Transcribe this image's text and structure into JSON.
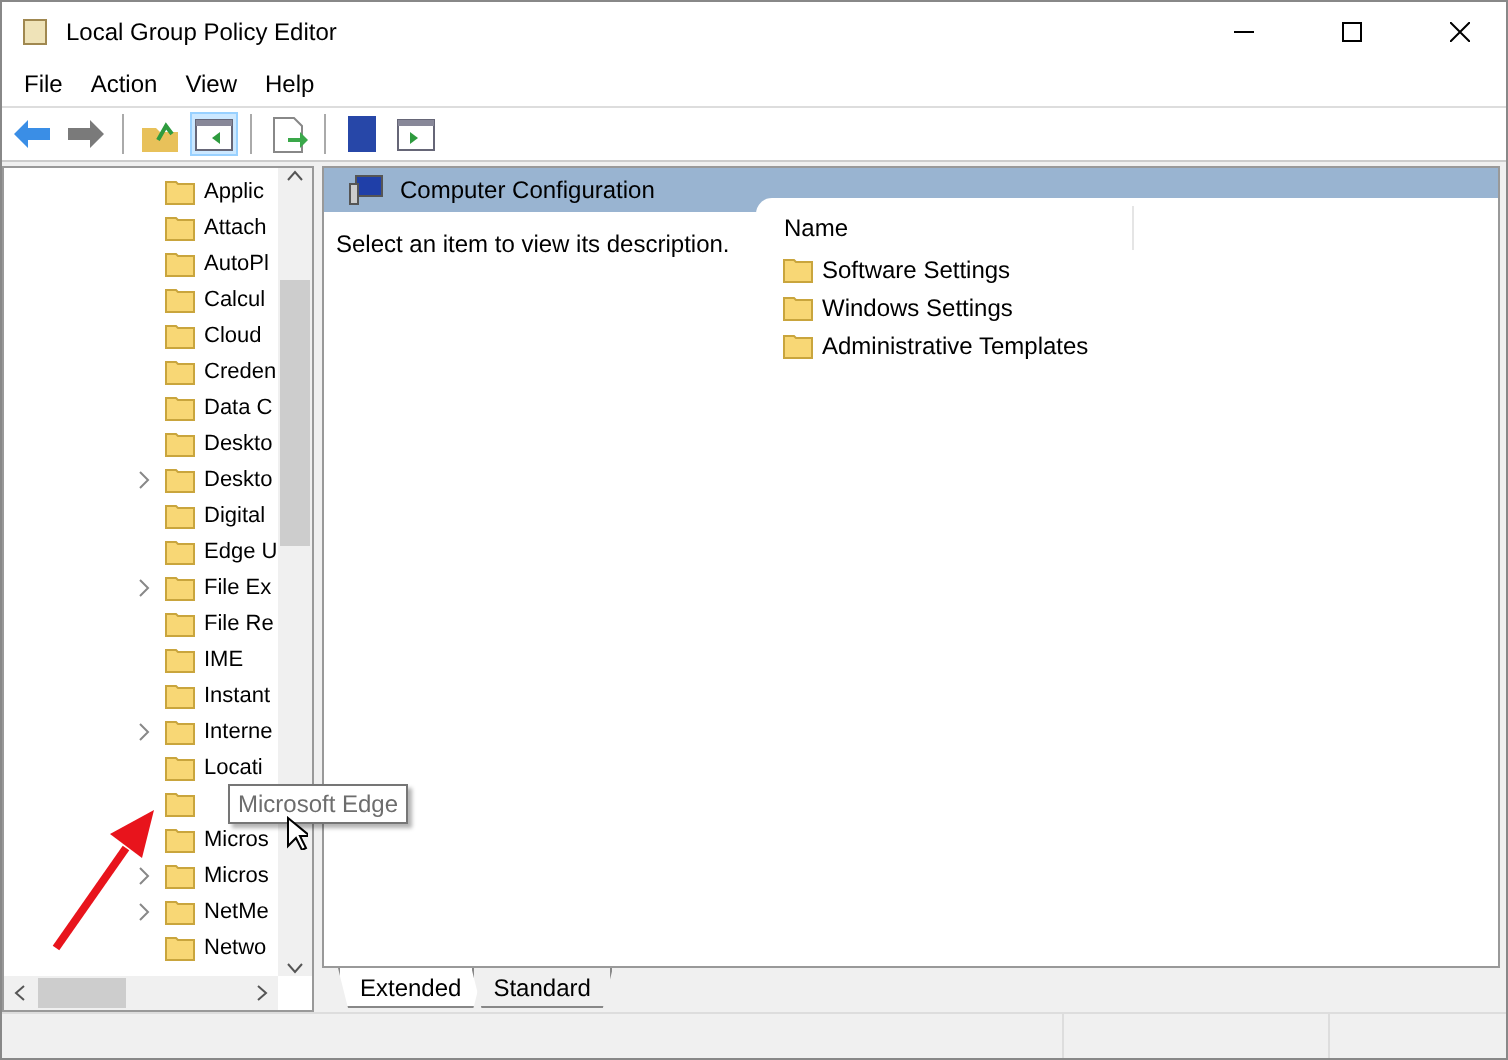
{
  "window": {
    "title": "Local Group Policy Editor"
  },
  "menu": [
    "File",
    "Action",
    "View",
    "Help"
  ],
  "toolbar": [
    {
      "kind": "back",
      "selected": false
    },
    {
      "kind": "forward",
      "selected": false
    },
    {
      "kind": "sep"
    },
    {
      "kind": "up",
      "selected": false
    },
    {
      "kind": "tree",
      "selected": true
    },
    {
      "kind": "sep"
    },
    {
      "kind": "export",
      "selected": false
    },
    {
      "kind": "sep"
    },
    {
      "kind": "help",
      "selected": false
    },
    {
      "kind": "pane",
      "selected": false
    }
  ],
  "tree": {
    "items": [
      {
        "label": "Applic",
        "expandable": false
      },
      {
        "label": "Attach",
        "expandable": false
      },
      {
        "label": "AutoPl",
        "expandable": false
      },
      {
        "label": "Calcul",
        "expandable": false
      },
      {
        "label": "Cloud",
        "expandable": false
      },
      {
        "label": "Creden",
        "expandable": false
      },
      {
        "label": "Data C",
        "expandable": false
      },
      {
        "label": "Deskto",
        "expandable": false
      },
      {
        "label": "Deskto",
        "expandable": true
      },
      {
        "label": "Digital",
        "expandable": false
      },
      {
        "label": "Edge U",
        "expandable": false
      },
      {
        "label": "File Ex",
        "expandable": true
      },
      {
        "label": "File Re",
        "expandable": false
      },
      {
        "label": "IME",
        "expandable": false
      },
      {
        "label": "Instant",
        "expandable": false
      },
      {
        "label": "Interne",
        "expandable": true
      },
      {
        "label": "Locati",
        "expandable": false
      },
      {
        "tooltip": "Microsoft Edge",
        "expandable": false
      },
      {
        "label": "Micros",
        "expandable": false
      },
      {
        "label": "Micros",
        "expandable": true
      },
      {
        "label": "NetMe",
        "expandable": true
      },
      {
        "label": "Netwo",
        "expandable": false
      }
    ]
  },
  "details": {
    "header": "Computer Configuration",
    "description": "Select an item to view its description.",
    "column": "Name",
    "items": [
      "Software Settings",
      "Windows Settings",
      "Administrative Templates"
    ]
  },
  "tabs": [
    {
      "label": "Extended",
      "selected": true
    },
    {
      "label": "Standard",
      "selected": false
    }
  ]
}
